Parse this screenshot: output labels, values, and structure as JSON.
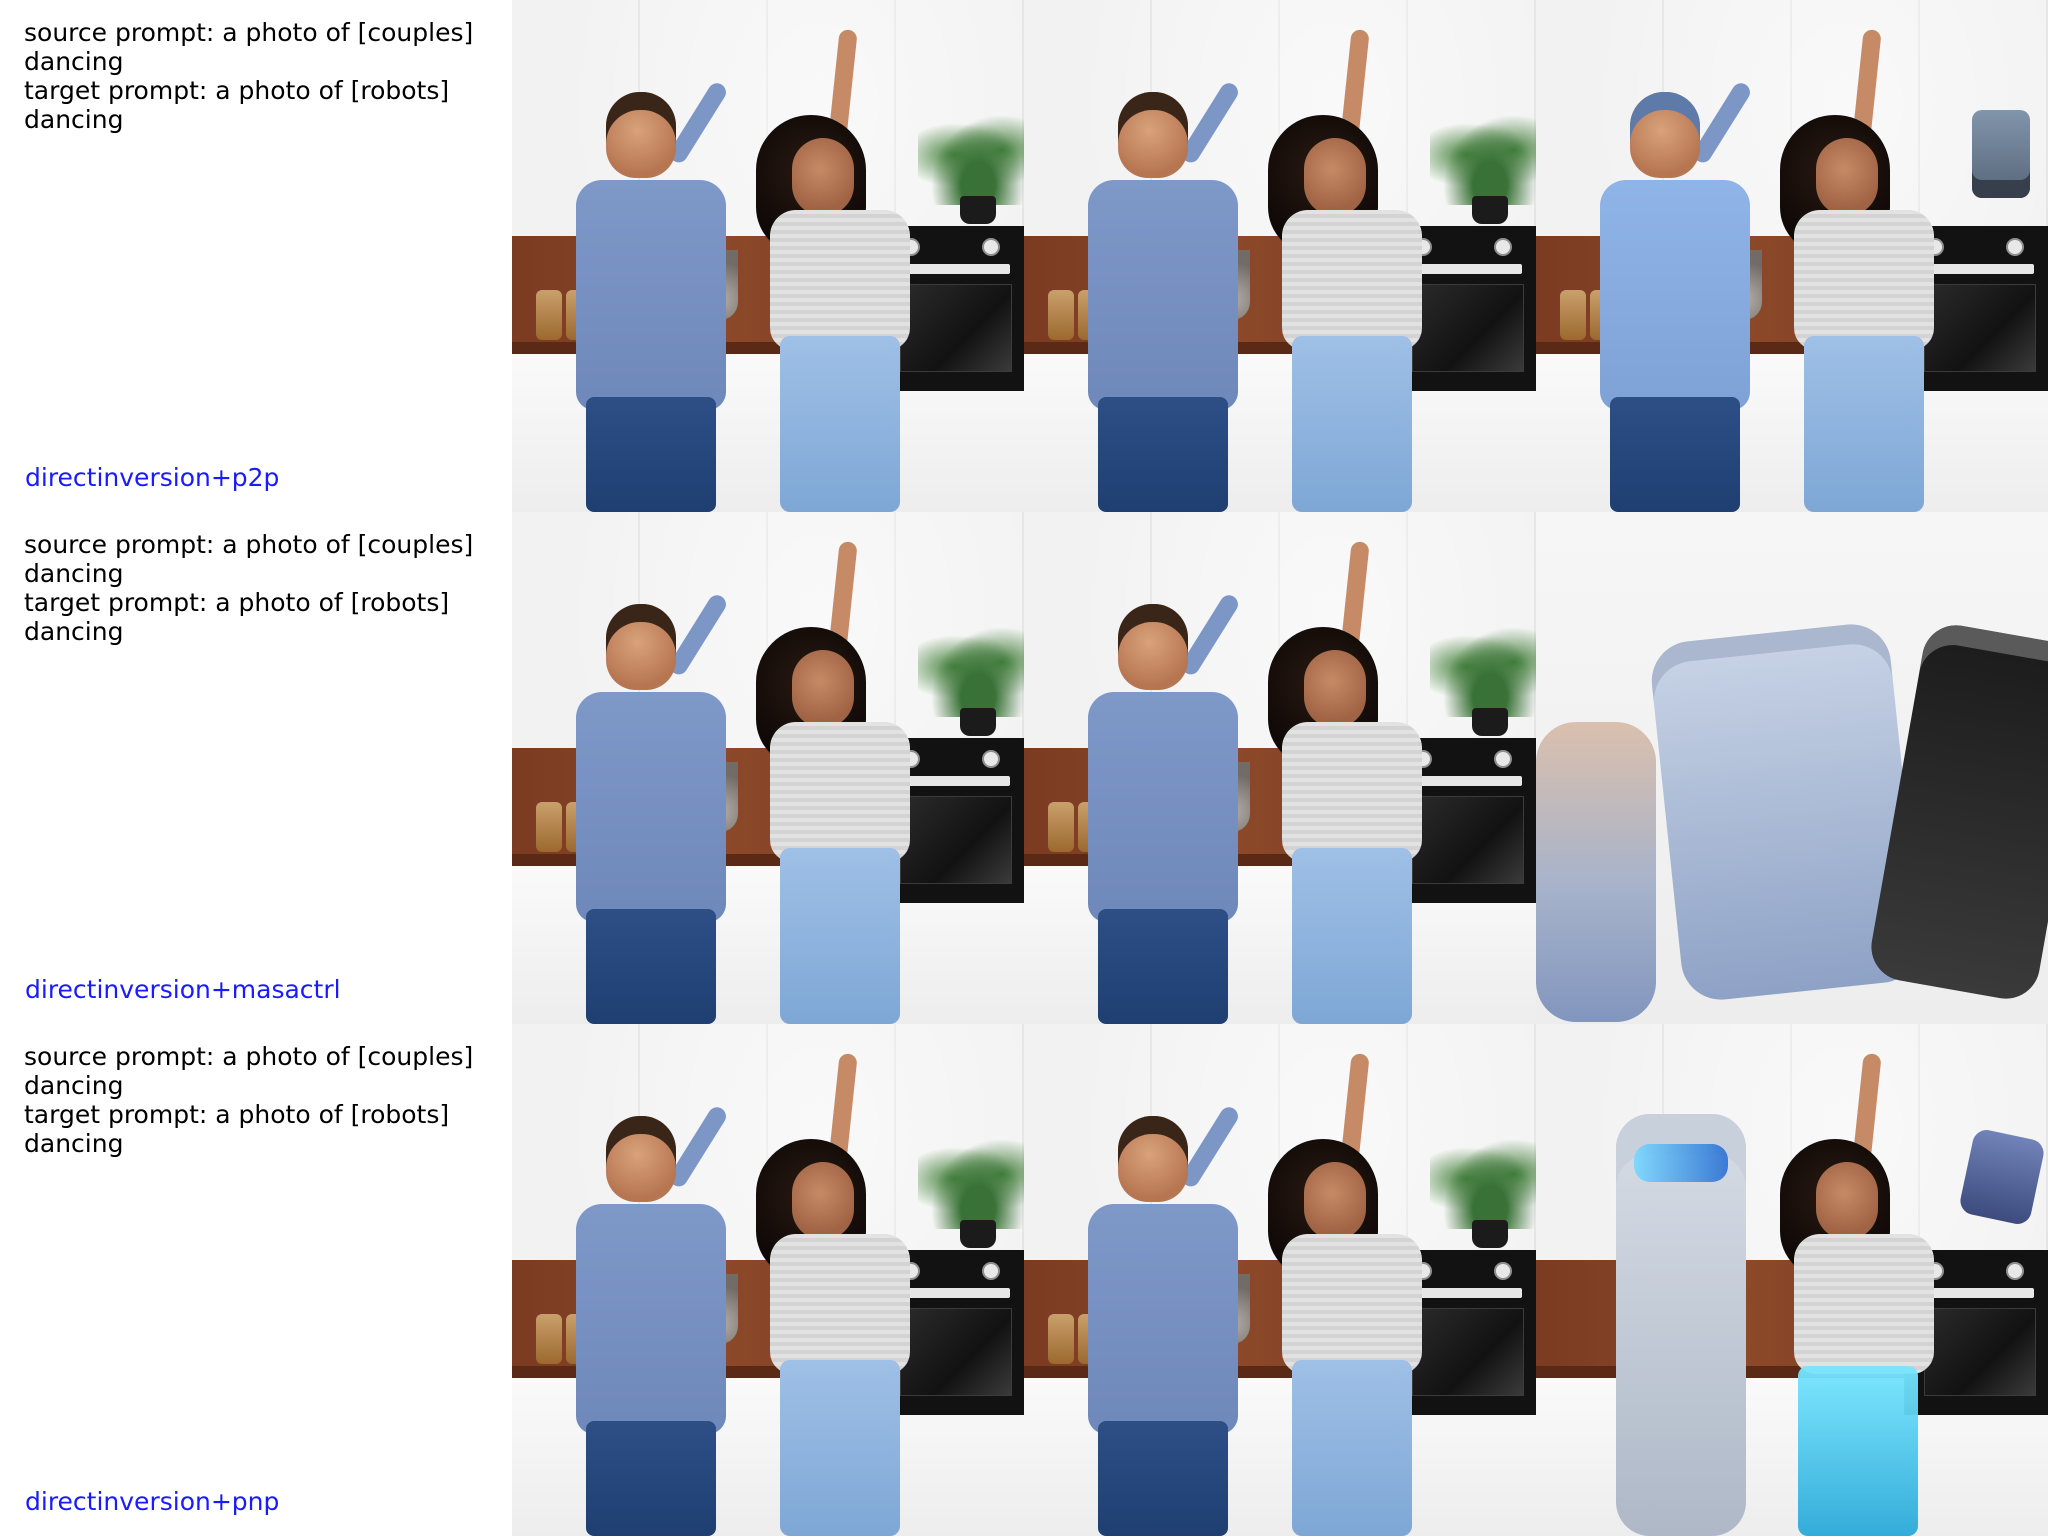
{
  "rows": [
    {
      "prompts": {
        "source_line_1": "source prompt: a photo of [couples]",
        "source_line_2": "dancing",
        "target_line_1": "target prompt: a photo of [robots]",
        "target_line_2": "dancing"
      },
      "method": {
        "label": "directinversion+p2p",
        "color": "#1a1aff"
      }
    },
    {
      "prompts": {
        "source_line_1": "source prompt: a photo of [couples]",
        "source_line_2": "dancing",
        "target_line_1": "target prompt: a photo of [robots]",
        "target_line_2": "dancing"
      },
      "method": {
        "label": "directinversion+masactrl",
        "color": "#1a1aff"
      }
    },
    {
      "prompts": {
        "source_line_1": "source prompt: a photo of [couples]",
        "source_line_2": "dancing",
        "target_line_1": "target prompt: a photo of [robots]",
        "target_line_2": "dancing"
      },
      "method": {
        "label": "directinversion+pnp",
        "color": "#1a1aff"
      }
    }
  ]
}
